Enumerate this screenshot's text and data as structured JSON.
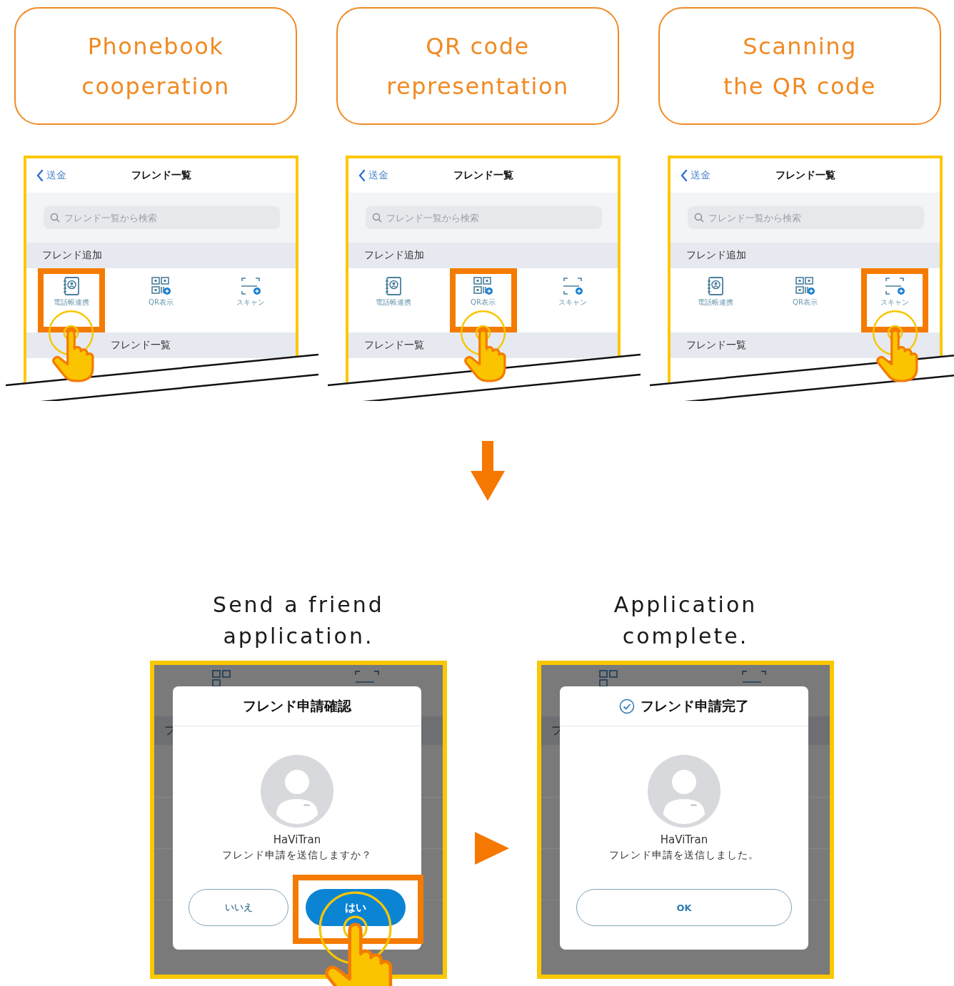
{
  "steps": [
    {
      "title_lines": [
        "Phonebook",
        "cooperation"
      ],
      "screen": {
        "back": "送金",
        "title": "フレンド一覧",
        "search_placeholder": "フレンド一覧から検索",
        "add_section": "フレンド追加",
        "list_section": "フレンド一覧",
        "items": [
          {
            "kind": "phonebook",
            "label": "電話帳連携",
            "selected": true
          },
          {
            "kind": "qr",
            "label": "QR表示",
            "selected": false
          },
          {
            "kind": "scan",
            "label": "スキャン",
            "selected": false
          }
        ]
      }
    },
    {
      "title_lines": [
        "QR code",
        "representation"
      ],
      "screen": {
        "back": "送金",
        "title": "フレンド一覧",
        "search_placeholder": "フレンド一覧から検索",
        "add_section": "フレンド追加",
        "list_section": "フレンド一覧",
        "items": [
          {
            "kind": "phonebook",
            "label": "電話帳連携",
            "selected": false
          },
          {
            "kind": "qr",
            "label": "QR表示",
            "selected": true
          },
          {
            "kind": "scan",
            "label": "スキャン",
            "selected": false
          }
        ]
      }
    },
    {
      "title_lines": [
        "Scanning",
        "the QR code"
      ],
      "screen": {
        "back": "送金",
        "title": "フレンド一覧",
        "search_placeholder": "フレンド一覧から検索",
        "add_section": "フレンド追加",
        "list_section": "フレンド一覧",
        "items": [
          {
            "kind": "phonebook",
            "label": "電話帳連携",
            "selected": false
          },
          {
            "kind": "qr",
            "label": "QR表示",
            "selected": false
          },
          {
            "kind": "scan",
            "label": "スキャン",
            "selected": true
          }
        ]
      }
    }
  ],
  "dialogs": [
    {
      "caption_lines": [
        "Send a friend",
        "application."
      ],
      "backdrop_text": "フ",
      "title": "フレンド申請確認",
      "title_check": false,
      "name": "HaViTran",
      "message": "フレンド申請を送信しますか？",
      "buttons": [
        {
          "label": "いいえ",
          "kind": "outline",
          "selected": false
        },
        {
          "label": "はい",
          "kind": "primary",
          "selected": true
        }
      ]
    },
    {
      "caption_lines": [
        "Application",
        "complete."
      ],
      "backdrop_text": "フ",
      "title": "フレンド申請完了",
      "title_check": true,
      "name": "HaViTran",
      "message": "フレンド申請を送信しました。",
      "buttons": [
        {
          "label": "OK",
          "kind": "wide",
          "selected": false
        }
      ]
    }
  ]
}
